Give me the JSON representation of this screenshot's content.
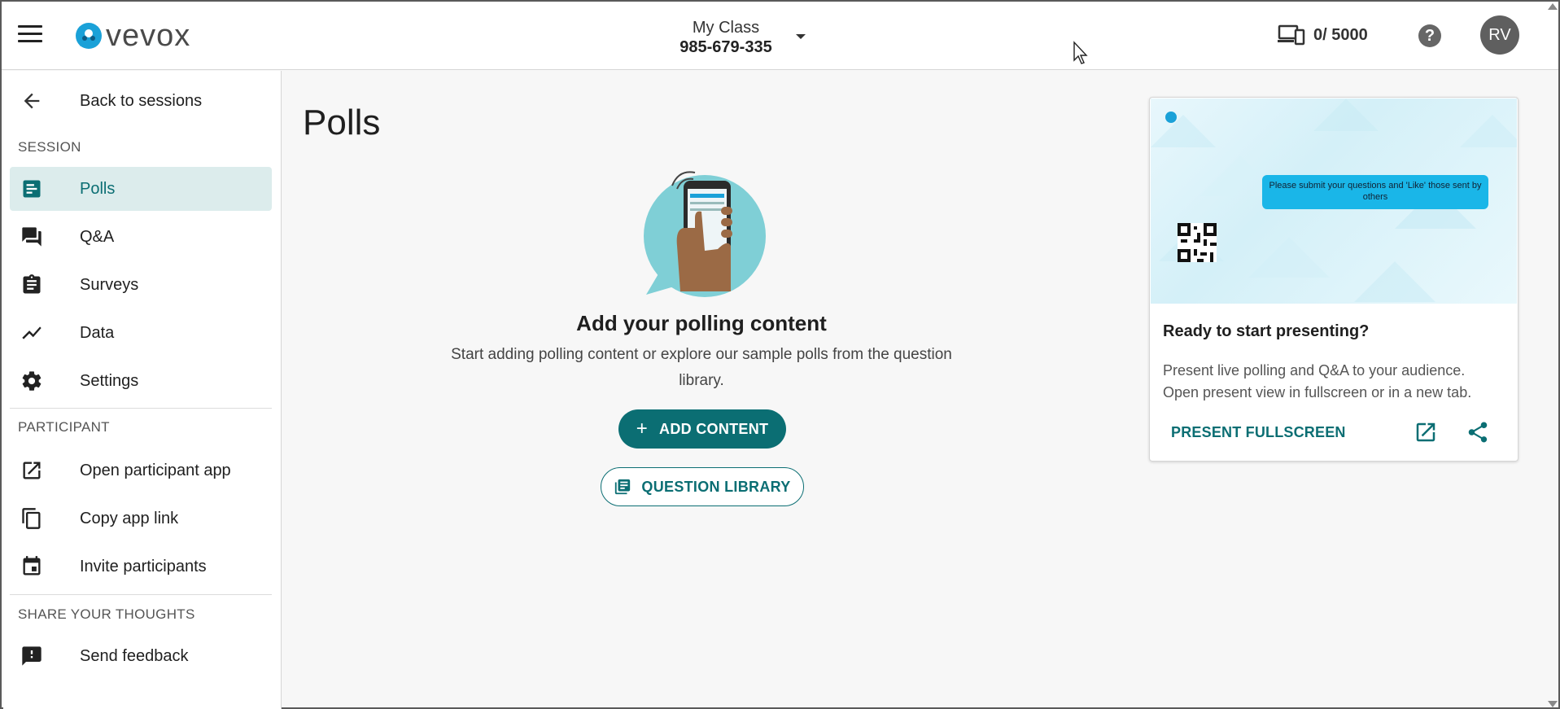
{
  "header": {
    "logo_text": "vevox",
    "session_name": "My Class",
    "session_code": "985-679-335",
    "device_count": "0/ 5000",
    "help_label": "?",
    "avatar_initials": "RV"
  },
  "sidebar": {
    "back_label": "Back to sessions",
    "session_title": "SESSION",
    "session_items": [
      {
        "label": "Polls",
        "icon": "polls-icon",
        "active": true
      },
      {
        "label": "Q&A",
        "icon": "forum-icon"
      },
      {
        "label": "Surveys",
        "icon": "clipboard-icon"
      },
      {
        "label": "Data",
        "icon": "trending-line-icon"
      },
      {
        "label": "Settings",
        "icon": "gear-icon"
      }
    ],
    "participant_title": "PARTICIPANT",
    "participant_items": [
      {
        "label": "Open participant app",
        "icon": "open-in-new-icon"
      },
      {
        "label": "Copy app link",
        "icon": "copy-icon"
      },
      {
        "label": "Invite participants",
        "icon": "calendar-icon"
      }
    ],
    "thoughts_title": "SHARE YOUR THOUGHTS",
    "thoughts_items": [
      {
        "label": "Send feedback",
        "icon": "feedback-icon"
      }
    ]
  },
  "main": {
    "page_title": "Polls",
    "empty_title": "Add your polling content",
    "empty_desc": "Start adding polling content or explore our sample polls from the question library.",
    "add_button": "ADD CONTENT",
    "add_button_icon": "+",
    "library_button": "QUESTION LIBRARY"
  },
  "card": {
    "preview_message": "Please submit your questions and 'Like' those sent by others",
    "title": "Ready to start presenting?",
    "description": "Present live polling and Q&A to your audience. Open present view in fullscreen or in a new tab.",
    "present_button": "PRESENT FULLSCREEN"
  },
  "colors": {
    "accent": "#0b6e73",
    "active_bg": "#dcecec",
    "preview_bubble": "#1ab6e8",
    "logo_blue": "#1aa1d8"
  }
}
